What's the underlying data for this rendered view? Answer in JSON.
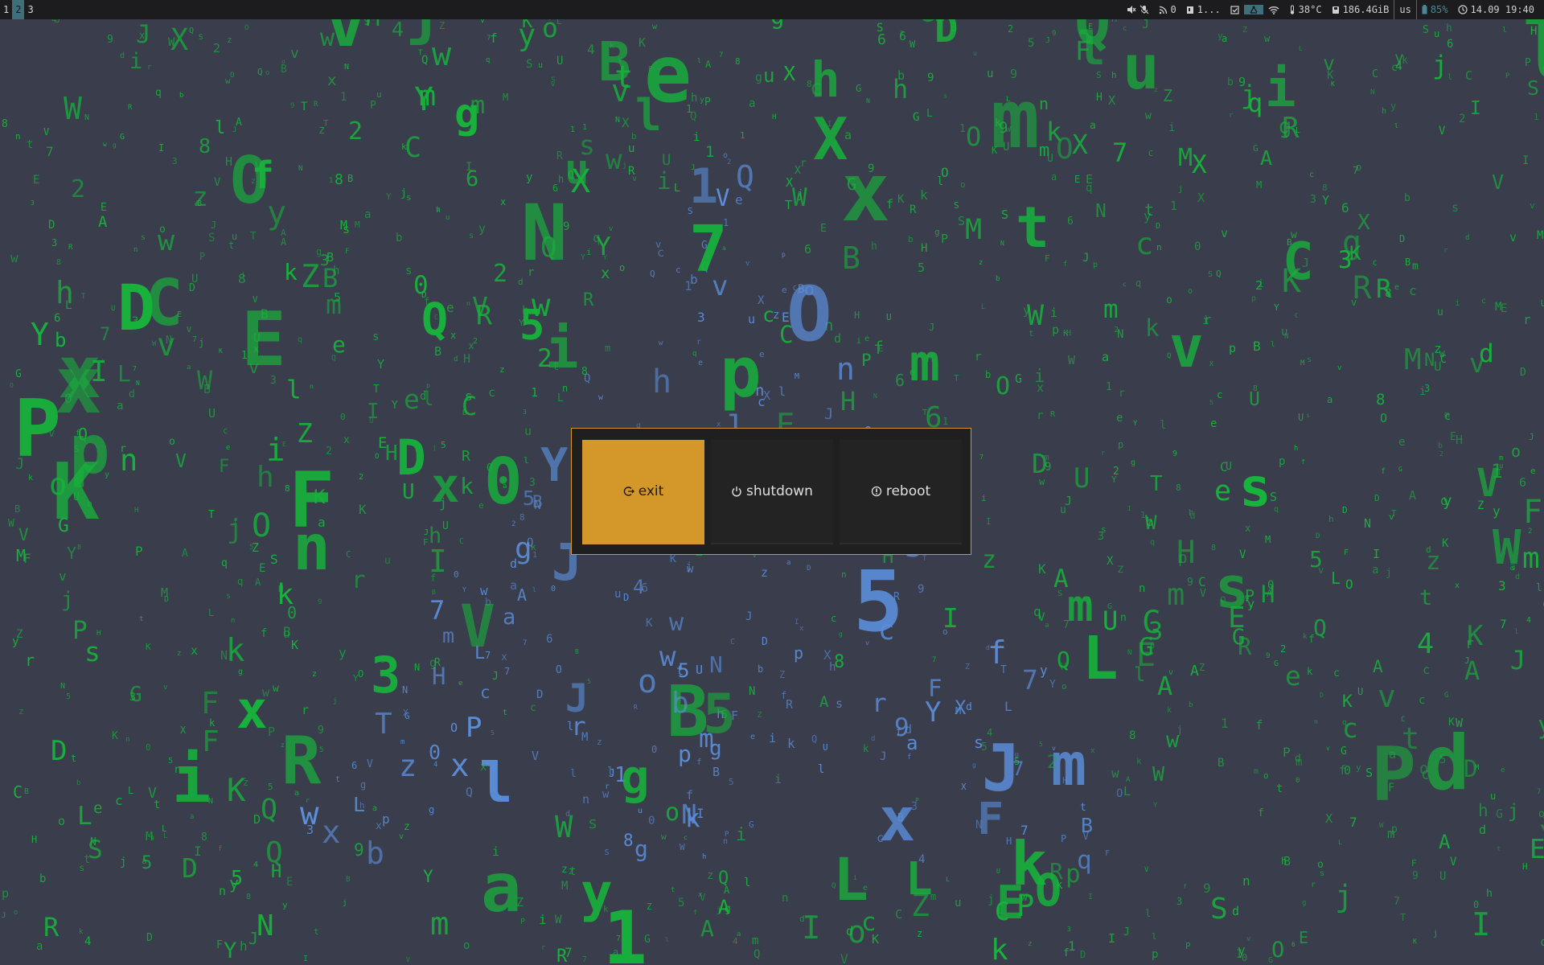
{
  "topbar": {
    "workspaces": [
      "1",
      "2",
      "3"
    ],
    "active_workspace": "2",
    "status": {
      "volume_icon": "speaker-muted-icon",
      "mic_icon": "microphone-muted-icon",
      "network_count": "0",
      "notes_text": "1...",
      "wifi_icon": "wifi-icon",
      "temperature": "38°C",
      "disk": "186.4GiB",
      "keyboard_layout": "us",
      "battery": "85%",
      "datetime": "14.09 19:40"
    },
    "colors": {
      "bar_bg": "#1c1c1f",
      "highlight": "#3e6f7a"
    }
  },
  "power_menu": {
    "buttons": [
      {
        "id": "exit",
        "label": "exit",
        "icon": "exit-icon"
      },
      {
        "id": "shutdown",
        "label": "shutdown",
        "icon": "power-icon"
      },
      {
        "id": "reboot",
        "label": "reboot",
        "icon": "reboot-icon"
      }
    ],
    "selected": "exit",
    "colors": {
      "accent": "#d4982a",
      "panel": "#1f1f1f",
      "button": "#232323"
    }
  },
  "wallpaper": {
    "theme": "matrix-rain-glyphs",
    "colors": {
      "background": "#3a3d4c",
      "green": "#17b33c",
      "blue": "#5b8fdc"
    }
  }
}
